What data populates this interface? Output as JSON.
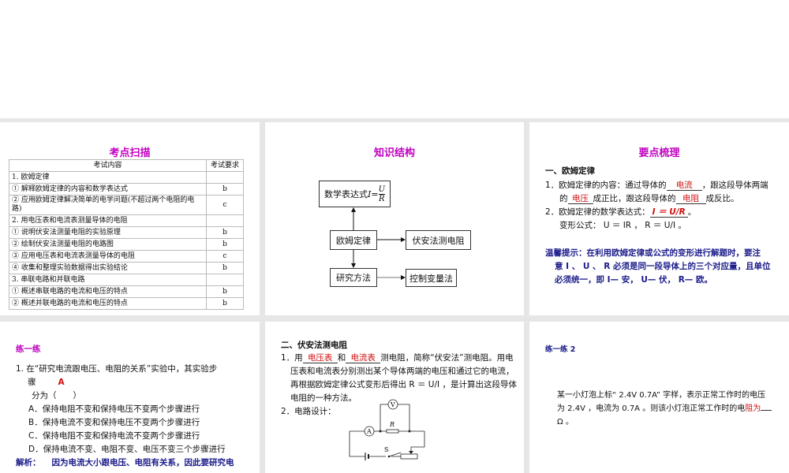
{
  "panel1": {
    "title": "考点扫描",
    "headers": [
      "考试内容",
      "考试要求"
    ],
    "rows": [
      [
        "1. 欧姆定律",
        ""
      ],
      [
        "① 解释欧姆定律的内容和数学表达式",
        "b"
      ],
      [
        "② 应用欧姆定律解决简单的电学问题(不超过两个电阻的电路)",
        "c"
      ],
      [
        "2. 用电压表和电流表测量导体的电阻",
        ""
      ],
      [
        "① 说明伏安法测量电阻的实验原理",
        "b"
      ],
      [
        "② 绘制伏安法测量电阻的电路图",
        "b"
      ],
      [
        "③ 应用电压表和电流表测量导体的电阻",
        "c"
      ],
      [
        "④ 收集和整理实验数据得出实验结论",
        "b"
      ],
      [
        "3. 串联电路和并联电路",
        ""
      ],
      [
        "① 概述串联电路的电流和电压的特点",
        "b"
      ],
      [
        "② 概述并联电路的电流和电压的特点",
        "b"
      ]
    ]
  },
  "panel2": {
    "title": "知识结构",
    "formula_label": "数学表达式",
    "formula": "I=",
    "num": "U",
    "den": "R",
    "ohm": "欧姆定律",
    "voltamm": "伏安法测电阻",
    "method": "研究方法",
    "control": "控制变量法"
  },
  "panel3": {
    "title": "要点梳理",
    "heading": "一、欧姆定律",
    "l1a": "1．欧姆定律的内容：通过导体的",
    "b1": "电流",
    "l1b": "，跟这段导体两端",
    "l2a": "的",
    "b2": "电压",
    "l2b": "成正比，跟这段导体的",
    "b3": "电阻",
    "l2c": "成反比。",
    "l3a": "2．欧姆定律的数学表达式：",
    "b4": "I ＝ U/R",
    "l3b": "。",
    "l4": "变形公式： U ＝ IR ， R ＝ U/I 。",
    "tip1": "温馨提示：在利用欧姆定律或公式的变形进行解题时，要注",
    "tip2": "意 I 、 U 、 R 必须是同一段导体上的三个对应量，且单位",
    "tip3": "必须统一，即 I— 安， U— 伏， R— 欧。"
  },
  "panel4": {
    "title": "练一练",
    "q1": "1.  在“研究电流跟电压、电阻的关系”实验中，其实验步",
    "q2": "骤",
    "answer": "A",
    "q3": "分为（　　）",
    "a": "A．保持电阻不变和保持电压不变两个步骤进行",
    "b": "B．保持电流不变和保持电压不变两个步骤进行",
    "c": "C．保持电阻不变和保持电流不变两个步骤进行",
    "d": "D．保持电流不变、电阻不变、电压不变三个步骤进行",
    "exp_label": "解析：",
    "exp": "因为电流大小跟电压、电阻有关系，因此要研究电"
  },
  "panel5": {
    "heading": "二、伏安法测电阻",
    "l1a": "1．用",
    "b1": "电压表",
    "l1b": "和",
    "b2": "电流表",
    "l1c": "测电阻，简称“伏安法”测电阻。用电",
    "l2": "压表和电流表分别测出某个导体两端的电压和通过它的电流，",
    "l3": "再根据欧姆定律公式变形后得出 R ＝ U/I ，是计算出这段导体",
    "l4": "电阻的一种方法。",
    "l5": "2．电路设计：",
    "v": "V",
    "a": "A",
    "r": "R",
    "s": "S"
  },
  "panel6": {
    "title": "练一练 2",
    "l1": "某一小灯泡上标“ 2.4V 0.7A” 字样，表示正常工作时的电压",
    "l2a": "为 2.4V ，电流为 0.7A 。则该小灯泡正常工作时的电",
    "l2r": "阻为",
    "l3": "Ω 。"
  }
}
